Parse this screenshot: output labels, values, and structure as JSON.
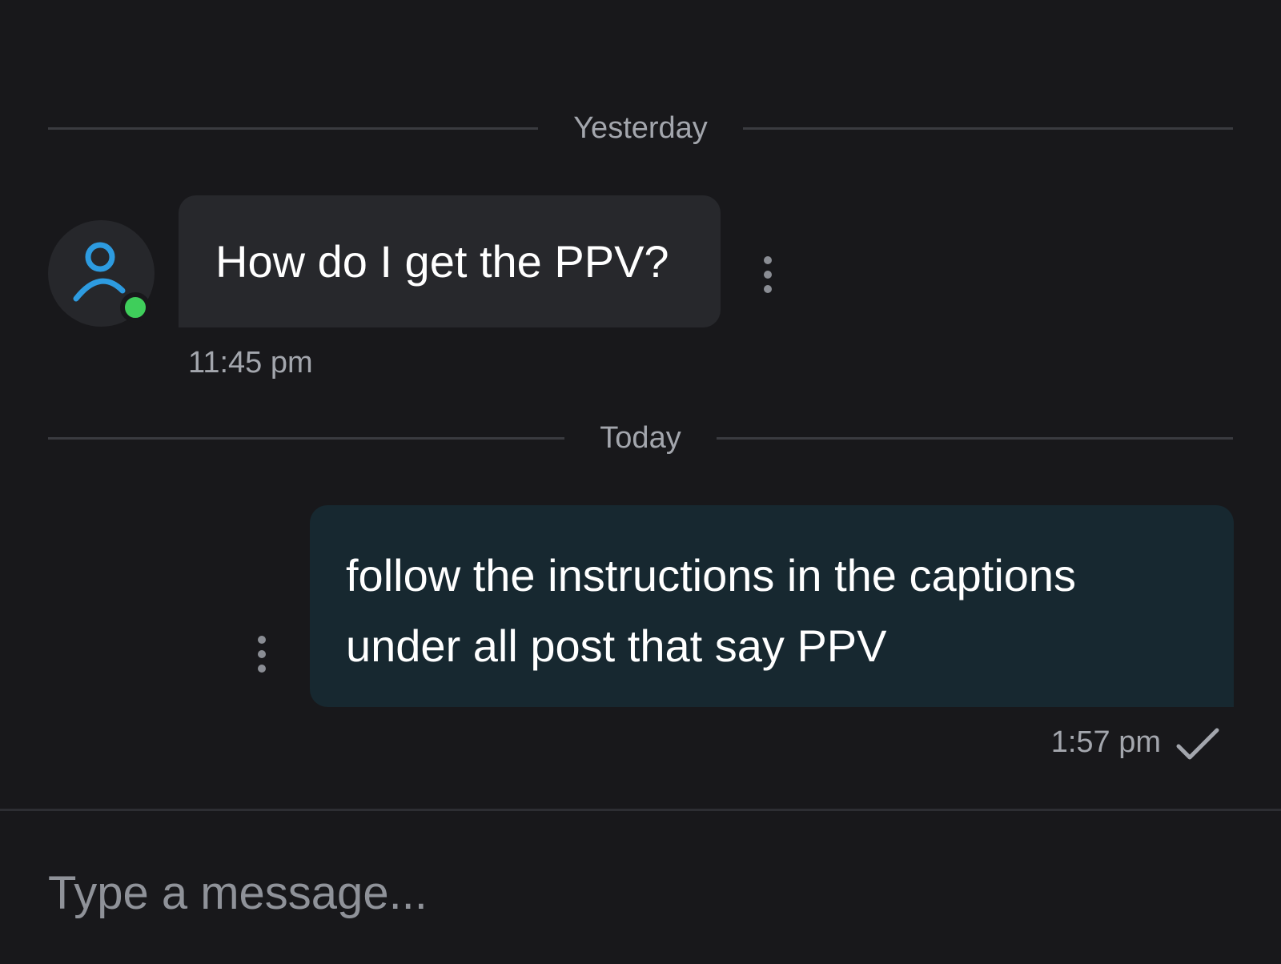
{
  "conversation": {
    "dividers": {
      "yesterday": "Yesterday",
      "today": "Today"
    },
    "incoming": {
      "text": "How do I get the PPV?",
      "time": "11:45 pm",
      "avatar_icon": "user-icon",
      "online": true
    },
    "outgoing": {
      "text": "follow the instructions in the captions under all post that say PPV",
      "time": "1:57 pm",
      "status_icon": "checkmark-icon"
    }
  },
  "composer": {
    "placeholder": "Type a message...",
    "value": ""
  },
  "colors": {
    "background": "#18181b",
    "incoming_bubble": "#27282c",
    "outgoing_bubble": "#172830",
    "online": "#3fce5b",
    "avatar_icon": "#2d9be0"
  }
}
